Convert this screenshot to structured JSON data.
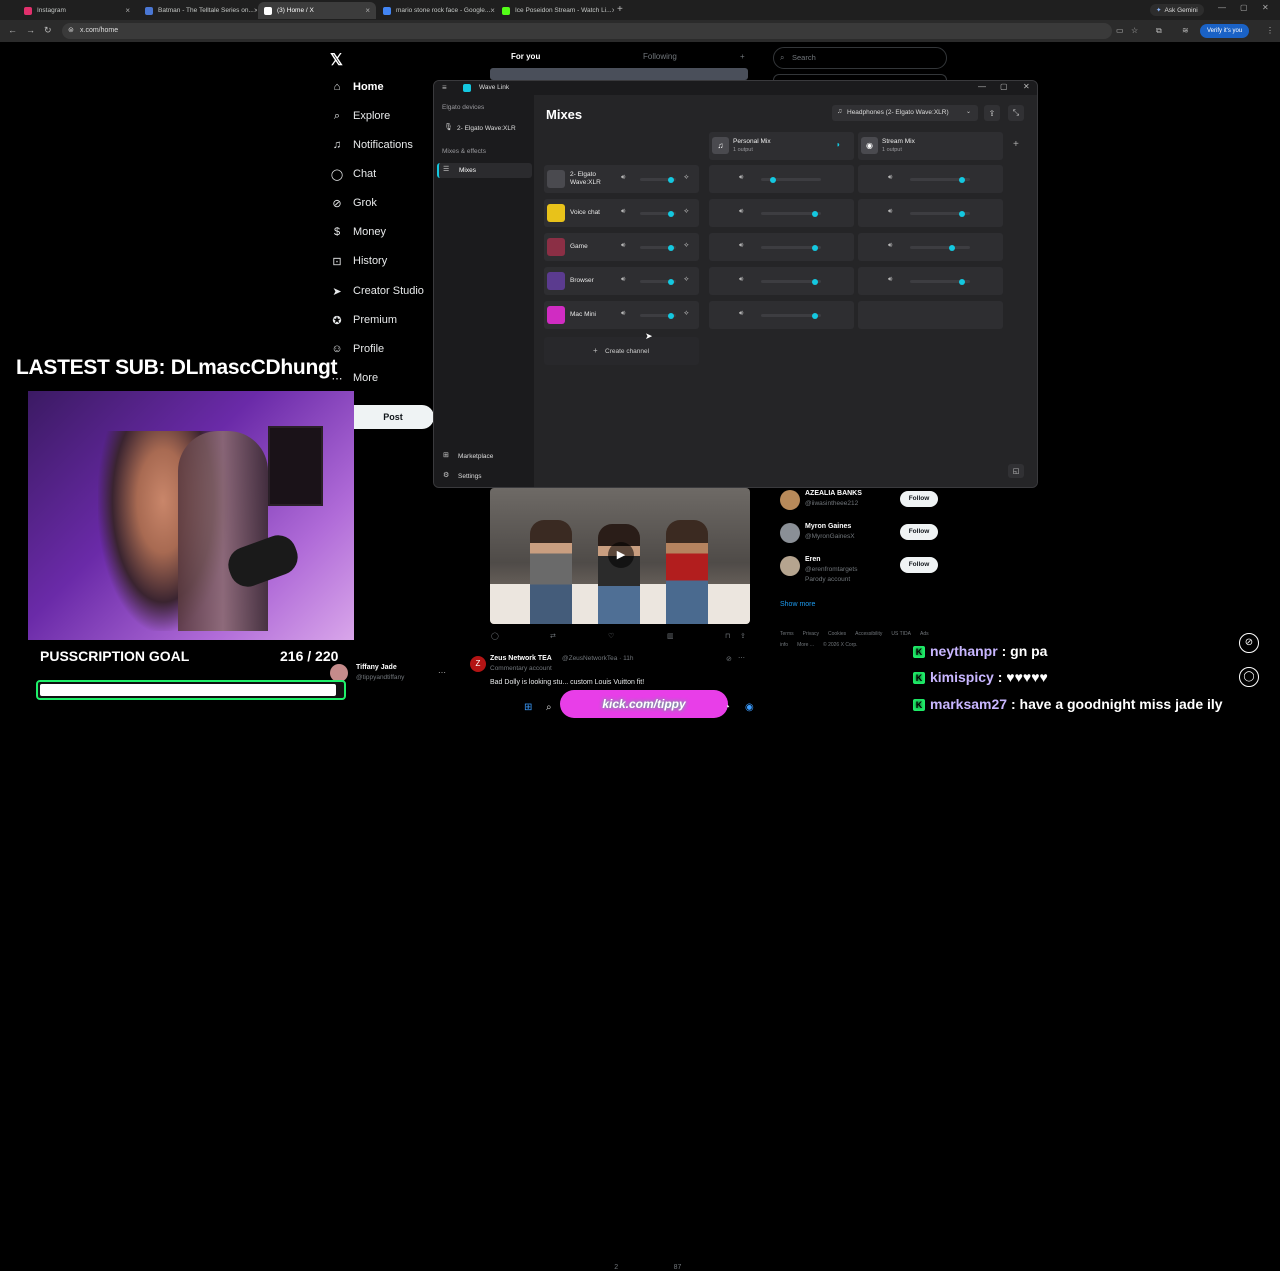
{
  "browser": {
    "tabs": [
      {
        "title": "Instagram",
        "color": "#e1306c"
      },
      {
        "title": "Batman - The Telltale Series on...",
        "color": "#4a77d4"
      },
      {
        "title": "(3) Home / X",
        "color": "#ffffff"
      },
      {
        "title": "mario stone rock face - Google...",
        "color": "#4285f4"
      },
      {
        "title": "Ice Poseidon Stream - Watch Li...",
        "color": "#53fc18"
      }
    ],
    "ask_gemini": "Ask Gemini",
    "url": "x.com/home",
    "verify": "Verify it's you"
  },
  "x": {
    "nav": [
      {
        "label": "Home",
        "icon": "⌂"
      },
      {
        "label": "Explore",
        "icon": "⌕"
      },
      {
        "label": "Notifications",
        "icon": "♫"
      },
      {
        "label": "Chat",
        "icon": "◯"
      },
      {
        "label": "Grok",
        "icon": "⊘"
      },
      {
        "label": "Money",
        "icon": "$"
      },
      {
        "label": "History",
        "icon": "⊡"
      },
      {
        "label": "Creator Studio",
        "icon": "➤"
      },
      {
        "label": "Premium",
        "icon": "✪"
      },
      {
        "label": "Profile",
        "icon": "☺"
      },
      {
        "label": "More",
        "icon": "⋯"
      }
    ],
    "post_button": "Post",
    "feed_tabs": [
      "For you",
      "Following"
    ],
    "search_placeholder": "Search",
    "who_to_follow": [
      {
        "name": "AZEALIA BANKS",
        "handle": "@iiwasintheee212",
        "extra": "",
        "color": "#b88a5a"
      },
      {
        "name": "Myron Gaines",
        "handle": "@MyronGainesX",
        "extra": "",
        "color": "#8a8f96"
      },
      {
        "name": "Eren",
        "handle": "@erenfromtargets",
        "extra": "Parody account",
        "color": "#b5a48f"
      }
    ],
    "follow_label": "Follow",
    "show_more": "Show more",
    "footer": [
      "Terms",
      "Privacy",
      "Cookies",
      "Accessibility",
      "US TIDA",
      "Ads info",
      "More ...",
      "© 2026 X Corp."
    ],
    "tweet_actions": {
      "likes": "2",
      "views": "87"
    },
    "tweet": {
      "name": "Zeus Network TEA",
      "handle": "@ZeusNetworkTea · 11h",
      "label": "Commentary account",
      "body": "Bad Dolly is looking stu... custom Louis Vuitton fit!"
    },
    "tiffany": {
      "name": "Tiffany Jade",
      "handle": "@tippyandtiffany"
    }
  },
  "wavelink": {
    "app_title": "Wave Link",
    "section_devices": "Elgato devices",
    "device": "2- Elgato Wave:XLR",
    "section_mixes": "Mixes & effects",
    "mixes_item": "Mixes",
    "marketplace": "Marketplace",
    "settings": "Settings",
    "heading": "Mixes",
    "output_select": "Headphones (2- Elgato Wave:XLR)",
    "mixes": [
      {
        "name": "Personal Mix",
        "sub": "1 output"
      },
      {
        "name": "Stream Mix",
        "sub": "1 output"
      }
    ],
    "channels": [
      {
        "name": "2- Elgato Wave:XLR",
        "line1": "2- Elgato",
        "line2": "Wave:XLR",
        "icon_color": "#4a4a4f",
        "main": 0.86,
        "personal": 0.2,
        "stream": 0.86
      },
      {
        "name": "Voice chat",
        "line1": "Voice chat",
        "line2": "",
        "icon_color": "#e8c21a",
        "main": 0.86,
        "personal": 0.9,
        "stream": 0.86
      },
      {
        "name": "Game",
        "line1": "Game",
        "line2": "",
        "icon_color": "#8b2f45",
        "main": 0.86,
        "personal": 0.9,
        "stream": 0.7
      },
      {
        "name": "Browser",
        "line1": "Browser",
        "line2": "",
        "icon_color": "#5b3b8f",
        "main": 0.86,
        "personal": 0.9,
        "stream": 0.86
      },
      {
        "name": "Mac Mini",
        "line1": "Mac Mini",
        "line2": "",
        "icon_color": "#d02cc2",
        "main": 0.86,
        "personal": 0.9,
        "stream": null
      }
    ],
    "create_channel": "Create channel"
  },
  "overlay": {
    "latest_sub": "LASTEST SUB: DLmascCDhungt",
    "goal_title": "PUSSCRIPTION GOAL",
    "goal_count": "216 / 220",
    "goal_progress": 0.98,
    "kick_url": "kick.com/tippy",
    "chat": [
      {
        "user": "neythanpr",
        "msg": "gn pa"
      },
      {
        "user": "kimispicy",
        "msg": "♥♥♥♥♥"
      },
      {
        "user": "marksam27",
        "msg": "have a goodnight miss jade ily"
      }
    ]
  }
}
